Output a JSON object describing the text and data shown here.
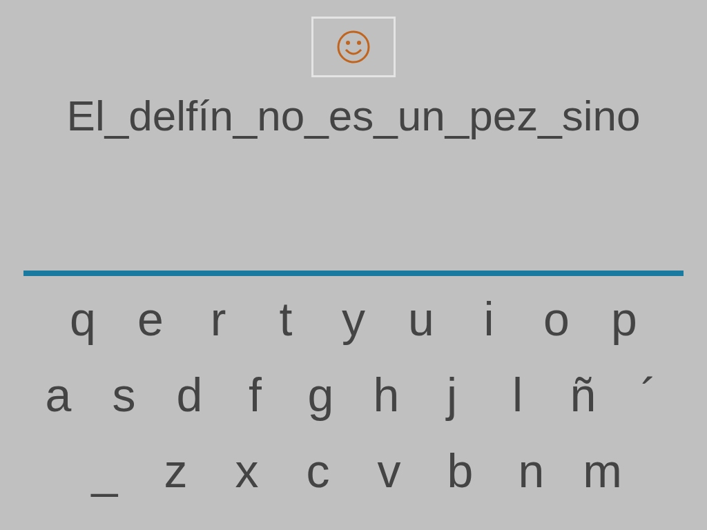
{
  "sentence": "El_delfín_no_es_un_pez_sino",
  "keyboard": {
    "rows": [
      [
        "q",
        "e",
        "r",
        "t",
        "y",
        "u",
        "i",
        "o",
        "p"
      ],
      [
        "a",
        "s",
        "d",
        "f",
        "g",
        "h",
        "j",
        "l",
        "ñ",
        "´"
      ],
      [
        "_",
        "z",
        "x",
        "c",
        "v",
        "b",
        "n",
        "m"
      ]
    ]
  }
}
